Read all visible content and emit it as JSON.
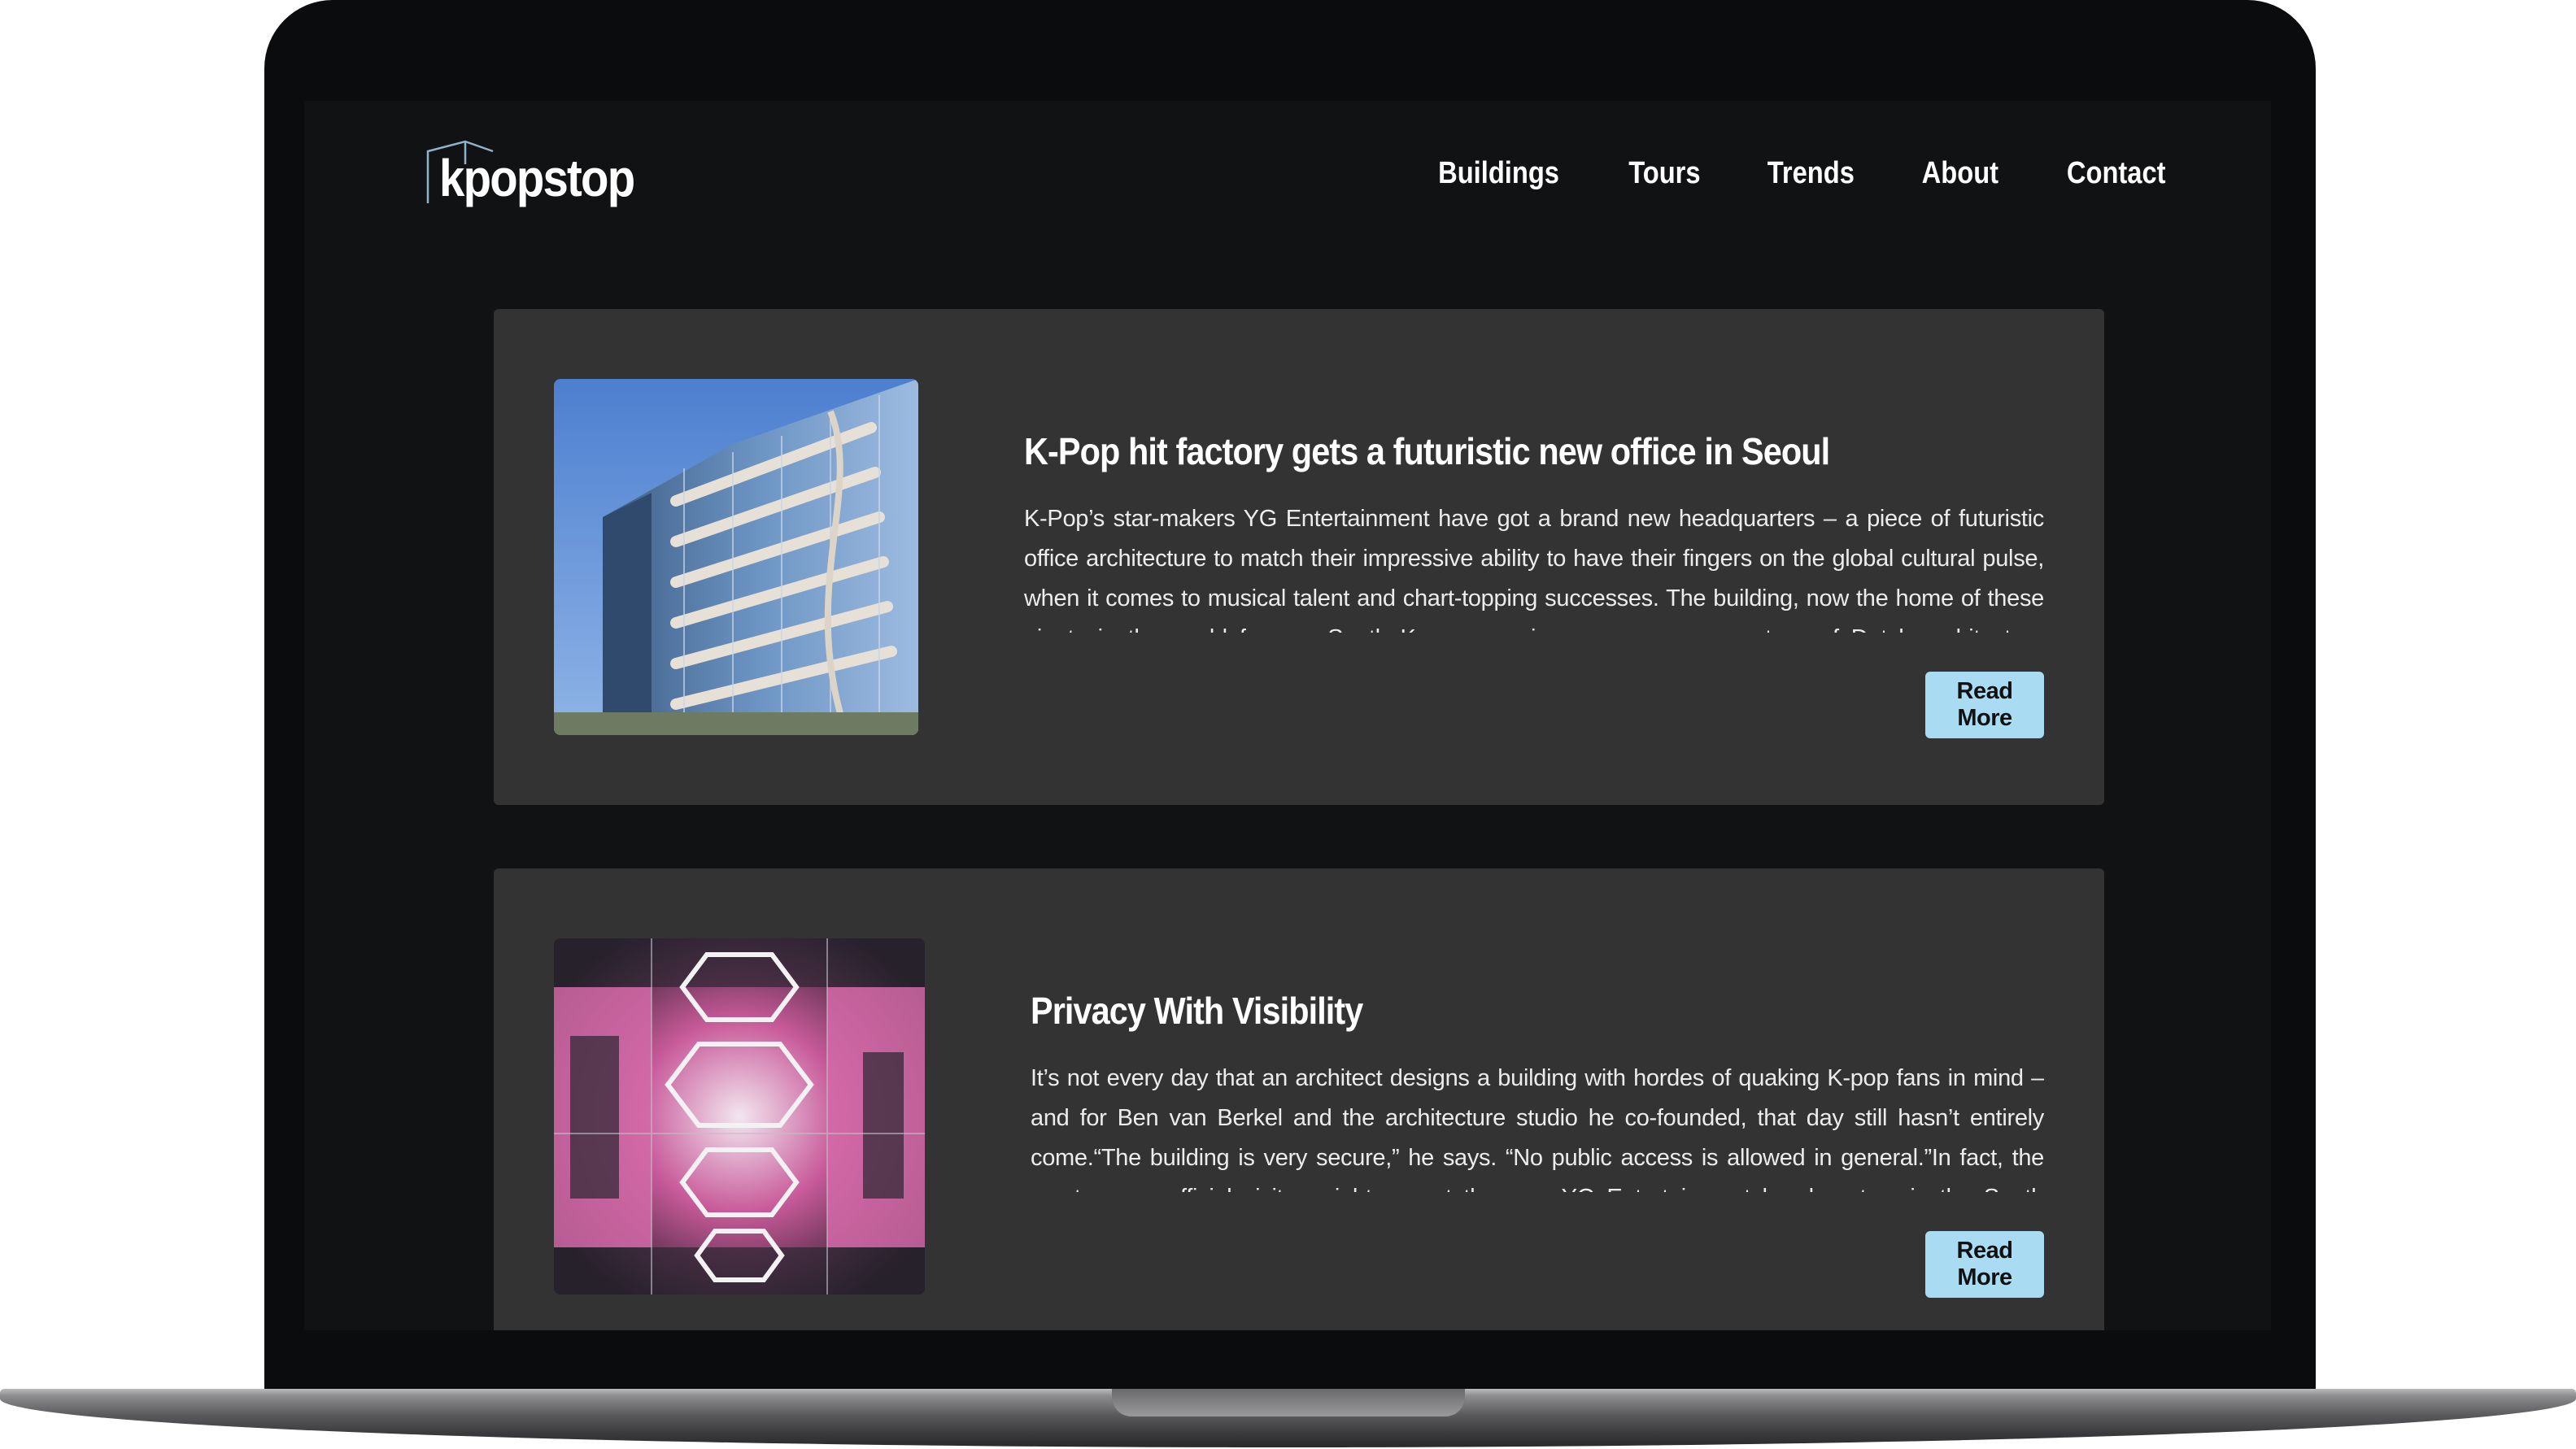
{
  "site": {
    "logo_text": "kpopstop",
    "nav": [
      "Buildings",
      "Tours",
      "Trends",
      "About",
      "Contact"
    ]
  },
  "articles": [
    {
      "title": "K-Pop hit factory gets a futuristic new office in Seoul",
      "excerpt": "K-Pop’s star-makers YG Entertainment have got a brand new headquarters – a piece of futuristic office architecture to match their impressive ability to have their fingers on the global cultural pulse, when it comes to musical talent and chart-topping successes. The building, now the home of these giants in the world famous South Korean music scene, comes courtesy of Dutch architecture practice UNStudio",
      "button": "Read More",
      "image": "glass-office-building-photo"
    },
    {
      "title": "Privacy With Visibility",
      "excerpt": "It’s not every day that an architect designs a building with hordes of quaking K-pop fans in mind – and for Ben van Berkel and the architecture studio he co-founded, that day still hasn’t entirely come.“The building is very secure,” he says. “No public access is allowed in general.”In fact, the most any unofficial visitor might see at the new YG Entertainment headquarters in the South Korean capital",
      "button": "Read More",
      "image": "atrium-interior-photo"
    }
  ],
  "colors": {
    "page_bg": "#111214",
    "card_bg": "#333333",
    "button_bg": "#a9dcf3",
    "text": "#ffffff"
  }
}
